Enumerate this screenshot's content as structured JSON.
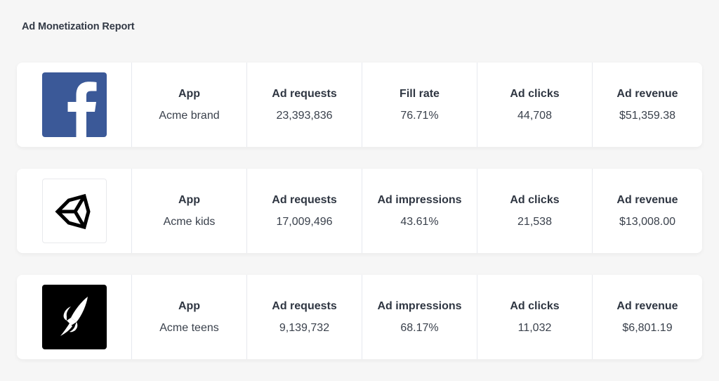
{
  "page": {
    "title": "Ad Monetization Report"
  },
  "rows": [
    {
      "logo": "facebook-logo",
      "metrics": [
        {
          "label": "App",
          "value": "Acme brand"
        },
        {
          "label": "Ad requests",
          "value": "23,393,836"
        },
        {
          "label": "Fill rate",
          "value": "76.71%"
        },
        {
          "label": "Ad clicks",
          "value": "44,708"
        },
        {
          "label": "Ad revenue",
          "value": "$51,359.38"
        }
      ]
    },
    {
      "logo": "unity-logo",
      "metrics": [
        {
          "label": "App",
          "value": "Acme kids"
        },
        {
          "label": "Ad requests",
          "value": "17,009,496"
        },
        {
          "label": "Ad impressions",
          "value": "43.61%"
        },
        {
          "label": "Ad clicks",
          "value": "21,538"
        },
        {
          "label": "Ad revenue",
          "value": "$13,008.00"
        }
      ]
    },
    {
      "logo": "rocket-logo",
      "metrics": [
        {
          "label": "App",
          "value": "Acme teens"
        },
        {
          "label": "Ad requests",
          "value": "9,139,732"
        },
        {
          "label": "Ad impressions",
          "value": "68.17%"
        },
        {
          "label": "Ad clicks",
          "value": "11,032"
        },
        {
          "label": "Ad revenue",
          "value": "$6,801.19"
        }
      ]
    }
  ],
  "colors": {
    "background": "#f6f6f6",
    "card": "#ffffff",
    "facebook_blue": "#3b5998",
    "text_dark": "#2f3642"
  }
}
